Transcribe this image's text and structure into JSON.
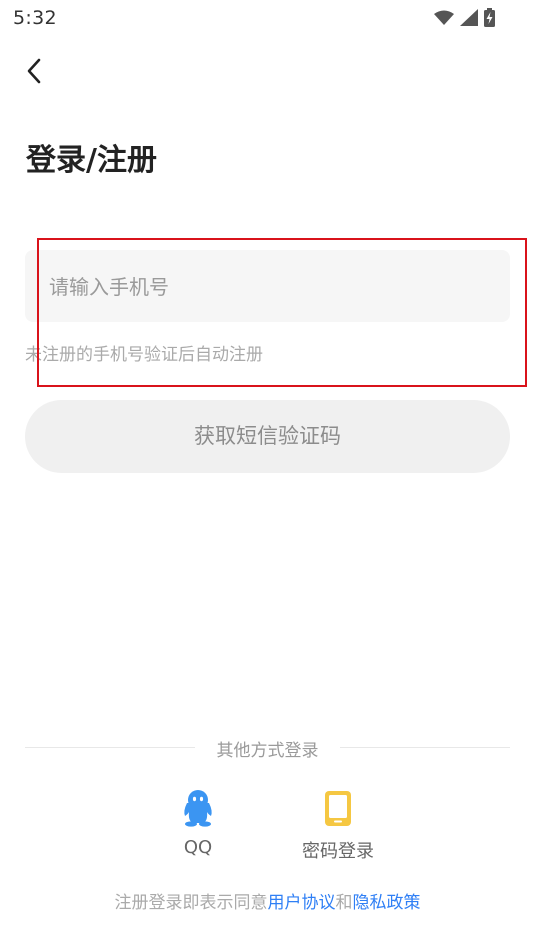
{
  "status_bar": {
    "time": "5:32",
    "icons": [
      "wifi-icon",
      "signal-icon",
      "battery-charging-icon"
    ]
  },
  "header": {
    "back_icon": "chevron-left-icon",
    "title": "登录/注册"
  },
  "phone_input": {
    "placeholder": "请输入手机号",
    "value": ""
  },
  "hint": "未注册的手机号验证后自动注册",
  "sms_button": {
    "label": "获取短信验证码"
  },
  "other_login": {
    "divider_label": "其他方式登录",
    "options": [
      {
        "label": "QQ",
        "icon": "qq-penguin-icon",
        "color": "#3b95f2"
      },
      {
        "label": "密码登录",
        "icon": "phone-icon",
        "color": "#f5c742"
      }
    ]
  },
  "agreement": {
    "prefix": "注册登录即表示同意",
    "user_agreement": "用户协议",
    "conjunction": "和",
    "privacy_policy": "隐私政策"
  },
  "colors": {
    "accent_link": "#2f7ff5",
    "highlight_border": "#d9131b",
    "input_background": "#f6f6f6",
    "button_background": "#f0f0f0"
  }
}
